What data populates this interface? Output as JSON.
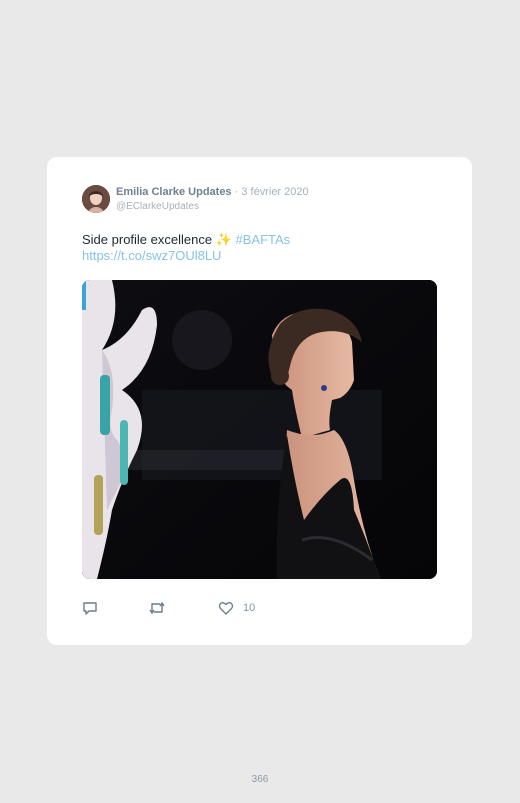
{
  "tweet": {
    "author_name": "Emilia Clarke Updates",
    "separator": "·",
    "date": "3 février 2020",
    "handle": "@EClarkeUpdates",
    "text": "Side profile excellence",
    "emoji": "✨",
    "hashtag": "#BAFTAs",
    "link": "https://t.co/swz7OUl8LU",
    "avatar_icon": "profile-photo",
    "photo_description_icon": "red-carpet-photo",
    "actions": {
      "reply_icon": "reply-icon",
      "retweet_icon": "retweet-icon",
      "like_icon": "heart-icon",
      "like_count": "10"
    }
  },
  "page": {
    "number": "366"
  },
  "colors": {
    "background": "#e9e9e9",
    "card": "#ffffff",
    "link": "#86c3e4",
    "name": "#6f8090",
    "muted": "#a7b1bb"
  }
}
